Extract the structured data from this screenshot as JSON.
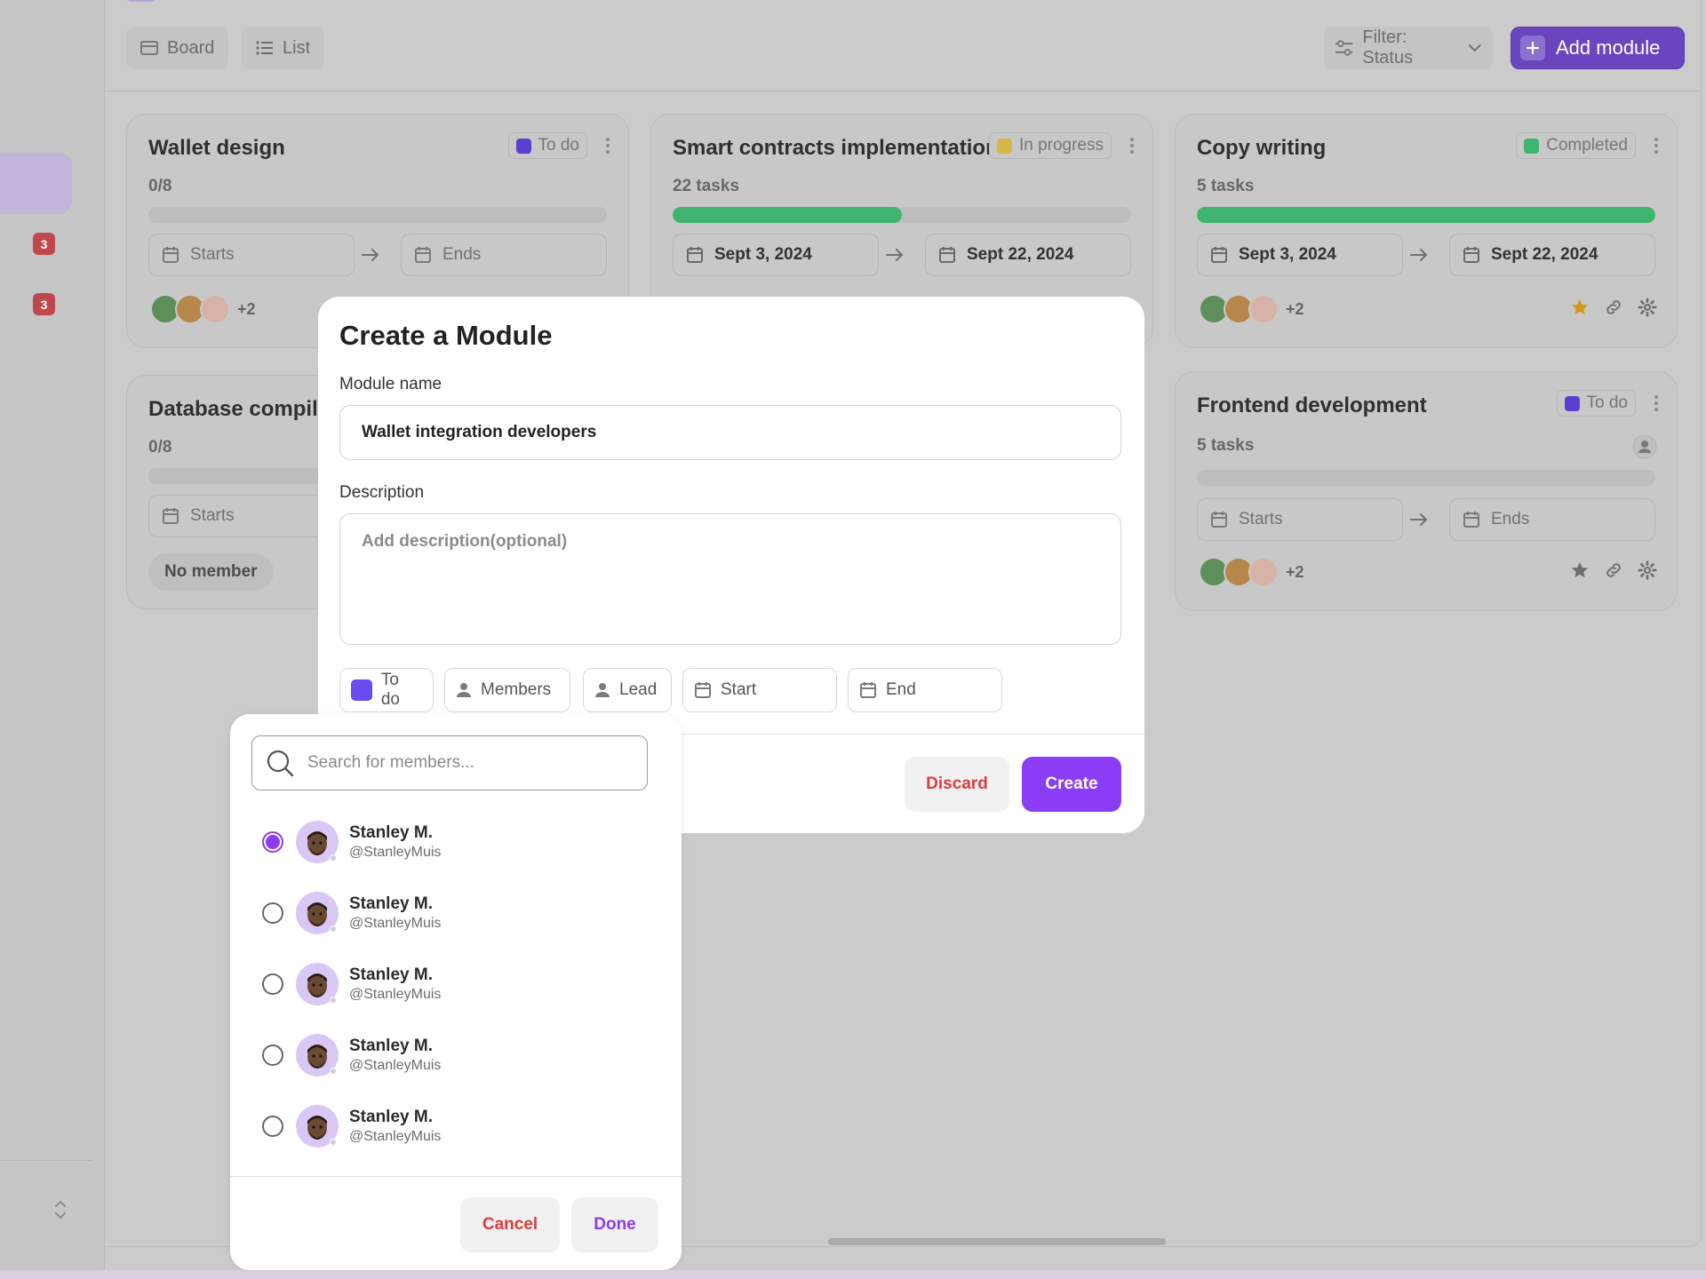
{
  "sidebar": {
    "badges": [
      "3",
      "3"
    ]
  },
  "toolbar": {
    "views": [
      {
        "label": "Board",
        "icon": "board-icon"
      },
      {
        "label": "List",
        "icon": "list-icon"
      }
    ],
    "filter_label": "Filter: Status",
    "add_module_label": "Add module"
  },
  "cards": [
    {
      "title": "Wallet design",
      "status": "To do",
      "status_color": "#5b3fd0",
      "subtitle": "0/8",
      "progress": 0,
      "start": "Starts",
      "end": "Ends",
      "more": "+2"
    },
    {
      "title": "Smart contracts implementation",
      "status": "In progress",
      "status_color": "#d9b64a",
      "subtitle": "22 tasks",
      "progress": 0.5,
      "start": "Sept 3, 2024",
      "end": "Sept 22, 2024"
    },
    {
      "title": "Copy writing",
      "status": "Completed",
      "status_color": "#3fb46e",
      "subtitle": "5 tasks",
      "progress": 1,
      "start": "Sept 3, 2024",
      "end": "Sept 22, 2024",
      "more": "+2"
    },
    {
      "title": "Database compiling",
      "subtitle": "0/8",
      "progress": 0,
      "start": "Starts",
      "no_member": "No member"
    },
    {
      "title": "Frontend development",
      "status": "To do",
      "status_color": "#5b3fd0",
      "subtitle": "5 tasks",
      "progress": 0,
      "start": "Starts",
      "end": "Ends",
      "more": "+2"
    }
  ],
  "modal": {
    "title": "Create a Module",
    "name_label": "Module name",
    "name_value": "Wallet integration developers",
    "description_label": "Description",
    "description_placeholder": "Add description(optional)",
    "pills": {
      "status": "To do",
      "members": "Members",
      "lead": "Lead",
      "start": "Start",
      "end": "End"
    },
    "discard_label": "Discard",
    "create_label": "Create",
    "accent_color": "#8b3cf5"
  },
  "members_popover": {
    "search_placeholder": "Search for members...",
    "members": [
      {
        "name": "Stanley M.",
        "handle": "@StanleyMuis",
        "selected": true
      },
      {
        "name": "Stanley M.",
        "handle": "@StanleyMuis",
        "selected": false
      },
      {
        "name": "Stanley M.",
        "handle": "@StanleyMuis",
        "selected": false
      },
      {
        "name": "Stanley M.",
        "handle": "@StanleyMuis",
        "selected": false
      },
      {
        "name": "Stanley M.",
        "handle": "@StanleyMuis",
        "selected": false
      }
    ],
    "cancel_label": "Cancel",
    "done_label": "Done"
  }
}
